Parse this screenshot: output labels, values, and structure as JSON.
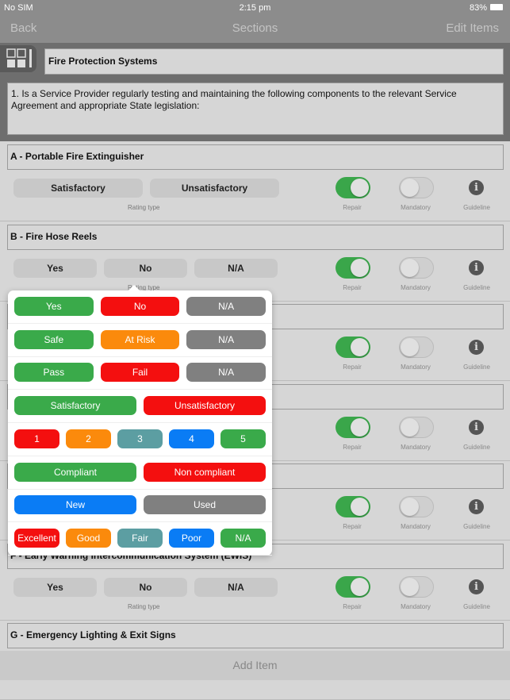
{
  "status": {
    "carrier": "No SIM",
    "time": "2:15 pm",
    "battery": "83%"
  },
  "nav": {
    "back": "Back",
    "title": "Sections",
    "edit": "Edit Items"
  },
  "header": {
    "section_title": "Fire Protection Systems",
    "question": "1. Is a Service Provider regularly testing and maintaining the following components to the relevant Service Agreement and appropriate State legislation:"
  },
  "labels": {
    "rating_type": "Rating type",
    "repair": "Repair",
    "mandatory": "Mandatory",
    "guideline": "Guideline"
  },
  "sections": [
    {
      "title": "A - Portable Fire Extinguisher",
      "options": [
        "Satisfactory",
        "Unsatisfactory"
      ],
      "repair": true,
      "mandatory": false
    },
    {
      "title": "B - Fire Hose Reels",
      "options": [
        "Yes",
        "No",
        "N/A"
      ],
      "repair": true,
      "mandatory": false
    },
    {
      "title": "",
      "options": [],
      "repair": true,
      "mandatory": false
    },
    {
      "title": "",
      "options": [],
      "repair": true,
      "mandatory": false
    },
    {
      "title": "",
      "options": [],
      "repair": true,
      "mandatory": false
    },
    {
      "title": "F - Early Warning Intercommunication System (EWIS)",
      "options": [
        "Yes",
        "No",
        "N/A"
      ],
      "repair": true,
      "mandatory": false
    },
    {
      "title": "G - Emergency Lighting & Exit Signs",
      "options": []
    }
  ],
  "add_item": "Add Item",
  "colors": {
    "green": "#3aaa4a",
    "red": "#f40f0f",
    "gray": "#808080",
    "orange": "#fb8a0c",
    "teal": "#5c9ea2",
    "blue": "#0a7cf5"
  },
  "rating_popup": [
    [
      {
        "label": "Yes",
        "color": "green"
      },
      {
        "label": "No",
        "color": "red"
      },
      {
        "label": "N/A",
        "color": "gray"
      }
    ],
    [
      {
        "label": "Safe",
        "color": "green"
      },
      {
        "label": "At Risk",
        "color": "orange"
      },
      {
        "label": "N/A",
        "color": "gray"
      }
    ],
    [
      {
        "label": "Pass",
        "color": "green"
      },
      {
        "label": "Fail",
        "color": "red"
      },
      {
        "label": "N/A",
        "color": "gray"
      }
    ],
    [
      {
        "label": "Satisfactory",
        "color": "green"
      },
      {
        "label": "Unsatisfactory",
        "color": "red"
      }
    ],
    [
      {
        "label": "1",
        "color": "red"
      },
      {
        "label": "2",
        "color": "orange"
      },
      {
        "label": "3",
        "color": "teal"
      },
      {
        "label": "4",
        "color": "blue"
      },
      {
        "label": "5",
        "color": "green"
      }
    ],
    [
      {
        "label": "Compliant",
        "color": "green"
      },
      {
        "label": "Non compliant",
        "color": "red"
      }
    ],
    [
      {
        "label": "New",
        "color": "blue"
      },
      {
        "label": "Used",
        "color": "gray"
      }
    ],
    [
      {
        "label": "Excellent",
        "color": "red"
      },
      {
        "label": "Good",
        "color": "orange"
      },
      {
        "label": "Fair",
        "color": "teal"
      },
      {
        "label": "Poor",
        "color": "blue"
      },
      {
        "label": "N/A",
        "color": "green"
      }
    ]
  ]
}
